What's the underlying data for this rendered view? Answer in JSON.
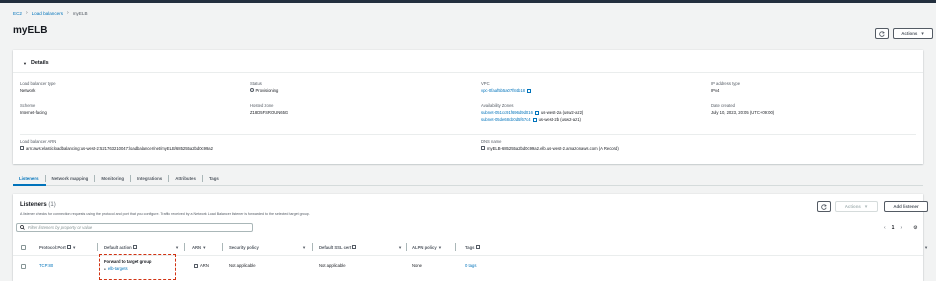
{
  "breadcrumb": [
    "EC2",
    "Load balancers",
    "myELB"
  ],
  "page_title": "myELB",
  "header_actions": {
    "actions_label": "Actions"
  },
  "details": {
    "title": "Details",
    "lb_type_label": "Load balancer type",
    "lb_type_value": "Network",
    "status_label": "Status",
    "status_value": "Provisioning",
    "vpc_label": "VPC",
    "vpc_value": "vpc-0faaf5b5a07f84b18",
    "ip_type_label": "IP address type",
    "ip_type_value": "IPv4",
    "scheme_label": "Scheme",
    "scheme_value": "Internet-facing",
    "zone_label": "Hosted zone",
    "zone_value": "Z18D5FSROUN65G",
    "az_label": "Availability Zones",
    "az1_subnet": "subnet-051cc91f696d9d016",
    "az1_zone": "us-west-2a (usw2-az2)",
    "az2_subnet": "subnet-05de68cb0d5f67c4",
    "az2_zone": "us-west-2b (usw2-az1)",
    "date_label": "Date created",
    "date_value": "July 10, 2023, 20:05 (UTC+09:00)",
    "arn_label": "Load balancer ARN",
    "arn_value": "arn:aws:elasticloadbalancing:us-west-2:521763210047:loadbalancer/net/myELB/685255a2bd0c99a2",
    "dns_label": "DNS name",
    "dns_value": "myELB-685255a2bd0c99a2.elb.us-west-2.amazonaws.com (A Record)"
  },
  "tabs": [
    "Listeners",
    "Network mapping",
    "Monitoring",
    "Integrations",
    "Attributes",
    "Tags"
  ],
  "listeners": {
    "title": "Listeners",
    "count": "(1)",
    "description": "A listener checks for connection requests using the protocol and port that you configure. Traffic received by a Network Load Balancer listener is forwarded to the selected target group.",
    "actions_label": "Actions",
    "add_label": "Add listener",
    "search_placeholder": "Filter listeners by property or value",
    "page_number": "1",
    "columns": [
      "Protocol:Port",
      "Default action",
      "ARN",
      "Security policy",
      "Default SSL cert",
      "ALPN policy",
      "Tags"
    ],
    "row": {
      "protocol_port": "TCP:80",
      "action_title": "Forward to target group",
      "action_target": "elb-targets",
      "arn": "ARN",
      "security_policy": "Not applicable",
      "ssl_cert": "Not applicable",
      "alpn_policy": "None",
      "tags": "0 tags"
    }
  },
  "colors": {
    "accent": "#0073bb",
    "highlight": "#d13212"
  }
}
